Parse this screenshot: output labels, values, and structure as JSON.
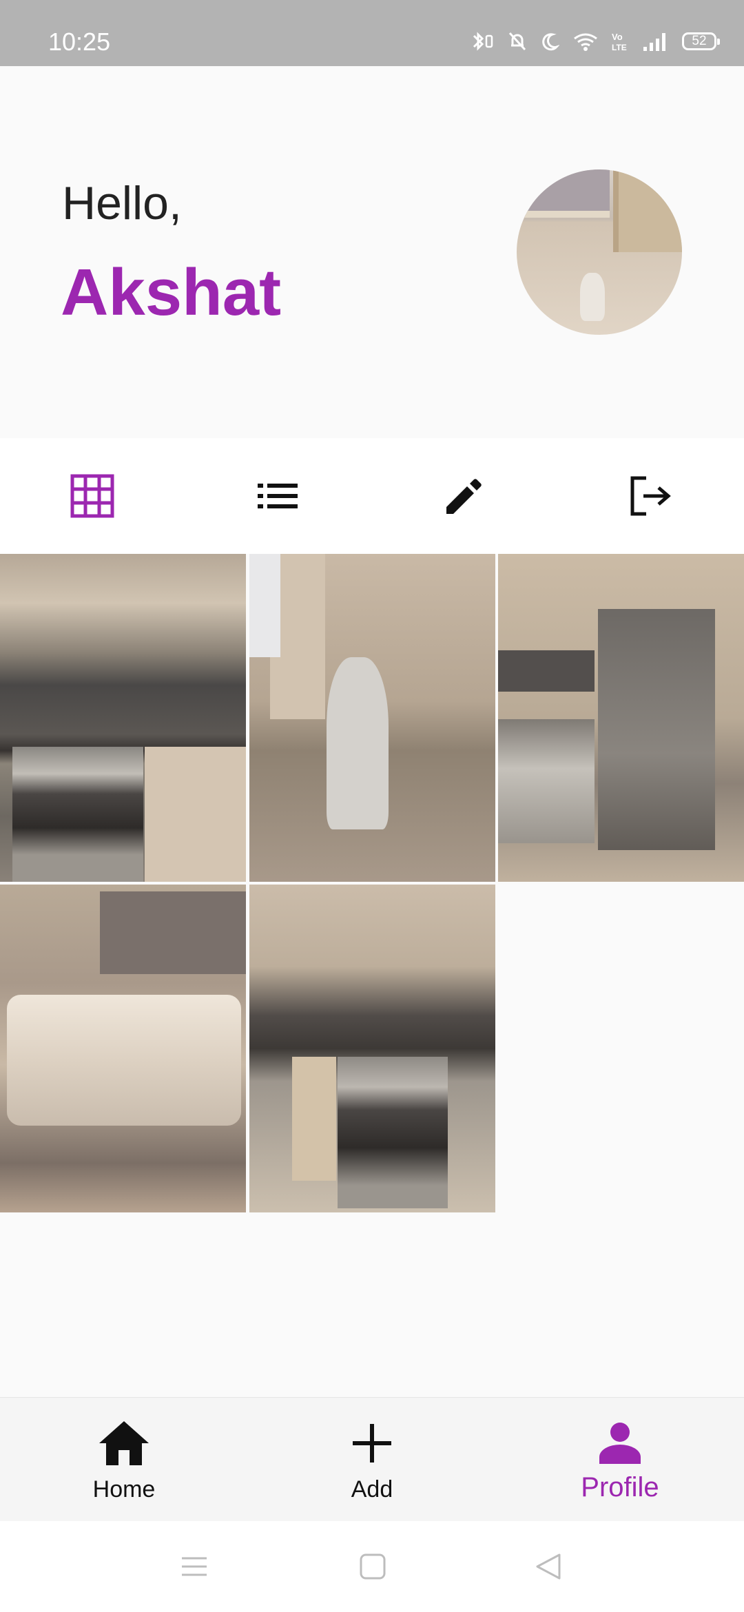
{
  "status_bar": {
    "time": "10:25",
    "battery": "52",
    "icons": [
      "bluetooth-icon",
      "mute-icon",
      "moon-icon",
      "wifi-icon",
      "volte-icon",
      "signal-icon",
      "battery-icon"
    ]
  },
  "header": {
    "greeting": "Hello,",
    "name": "Akshat"
  },
  "tabs": [
    {
      "icon": "grid-icon",
      "active": true
    },
    {
      "icon": "list-icon",
      "active": false
    },
    {
      "icon": "edit-pencil-icon",
      "active": false
    },
    {
      "icon": "logout-icon",
      "active": false
    }
  ],
  "grid": {
    "photos": [
      "kitchen-stove-photo",
      "dog-figure-photo",
      "fridge-photo",
      "sofa-photo",
      "kitchen-oven-photo"
    ]
  },
  "bottom_nav": {
    "items": [
      {
        "label": "Home",
        "icon": "home-icon",
        "active": false
      },
      {
        "label": "Add",
        "icon": "plus-icon",
        "active": false
      },
      {
        "label": "Profile",
        "icon": "person-icon",
        "active": true
      }
    ]
  },
  "colors": {
    "accent": "#9c27b0",
    "status_bar": "#b3b3b3",
    "background": "#fafafa"
  }
}
